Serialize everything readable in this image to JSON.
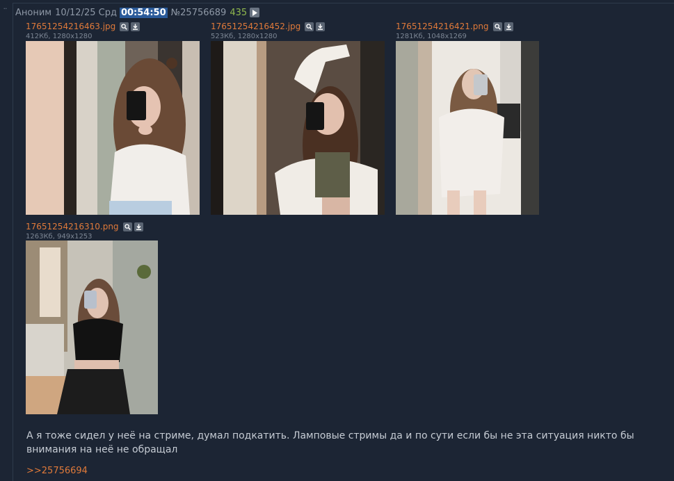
{
  "post": {
    "name": "Аноним",
    "date": "10/12/25 Срд",
    "time": "00:54:50",
    "number": "№25756689",
    "count": "435"
  },
  "files": [
    {
      "name": "17651254216463.jpg",
      "meta": "412Кб, 1280x1280"
    },
    {
      "name": "17651254216452.jpg",
      "meta": "523Кб, 1280x1280"
    },
    {
      "name": "17651254216421.png",
      "meta": "1281Кб, 1048x1269"
    },
    {
      "name": "17651254216310.png",
      "meta": "1263Кб, 949x1253"
    }
  ],
  "message": "А я тоже сидел у неё на стриме, думал подкатить. Ламповые стримы да и по сути если бы не эта ситуация никто бы внимания на неё не обращал",
  "reply": ">>25756694",
  "icons": {
    "play": "play-icon",
    "search": "search-icon",
    "download": "download-icon"
  },
  "colors": {
    "background": "#1c2534",
    "link": "#e07a3a",
    "count": "#8fb84e",
    "time_highlight": "#2a5a9a"
  }
}
